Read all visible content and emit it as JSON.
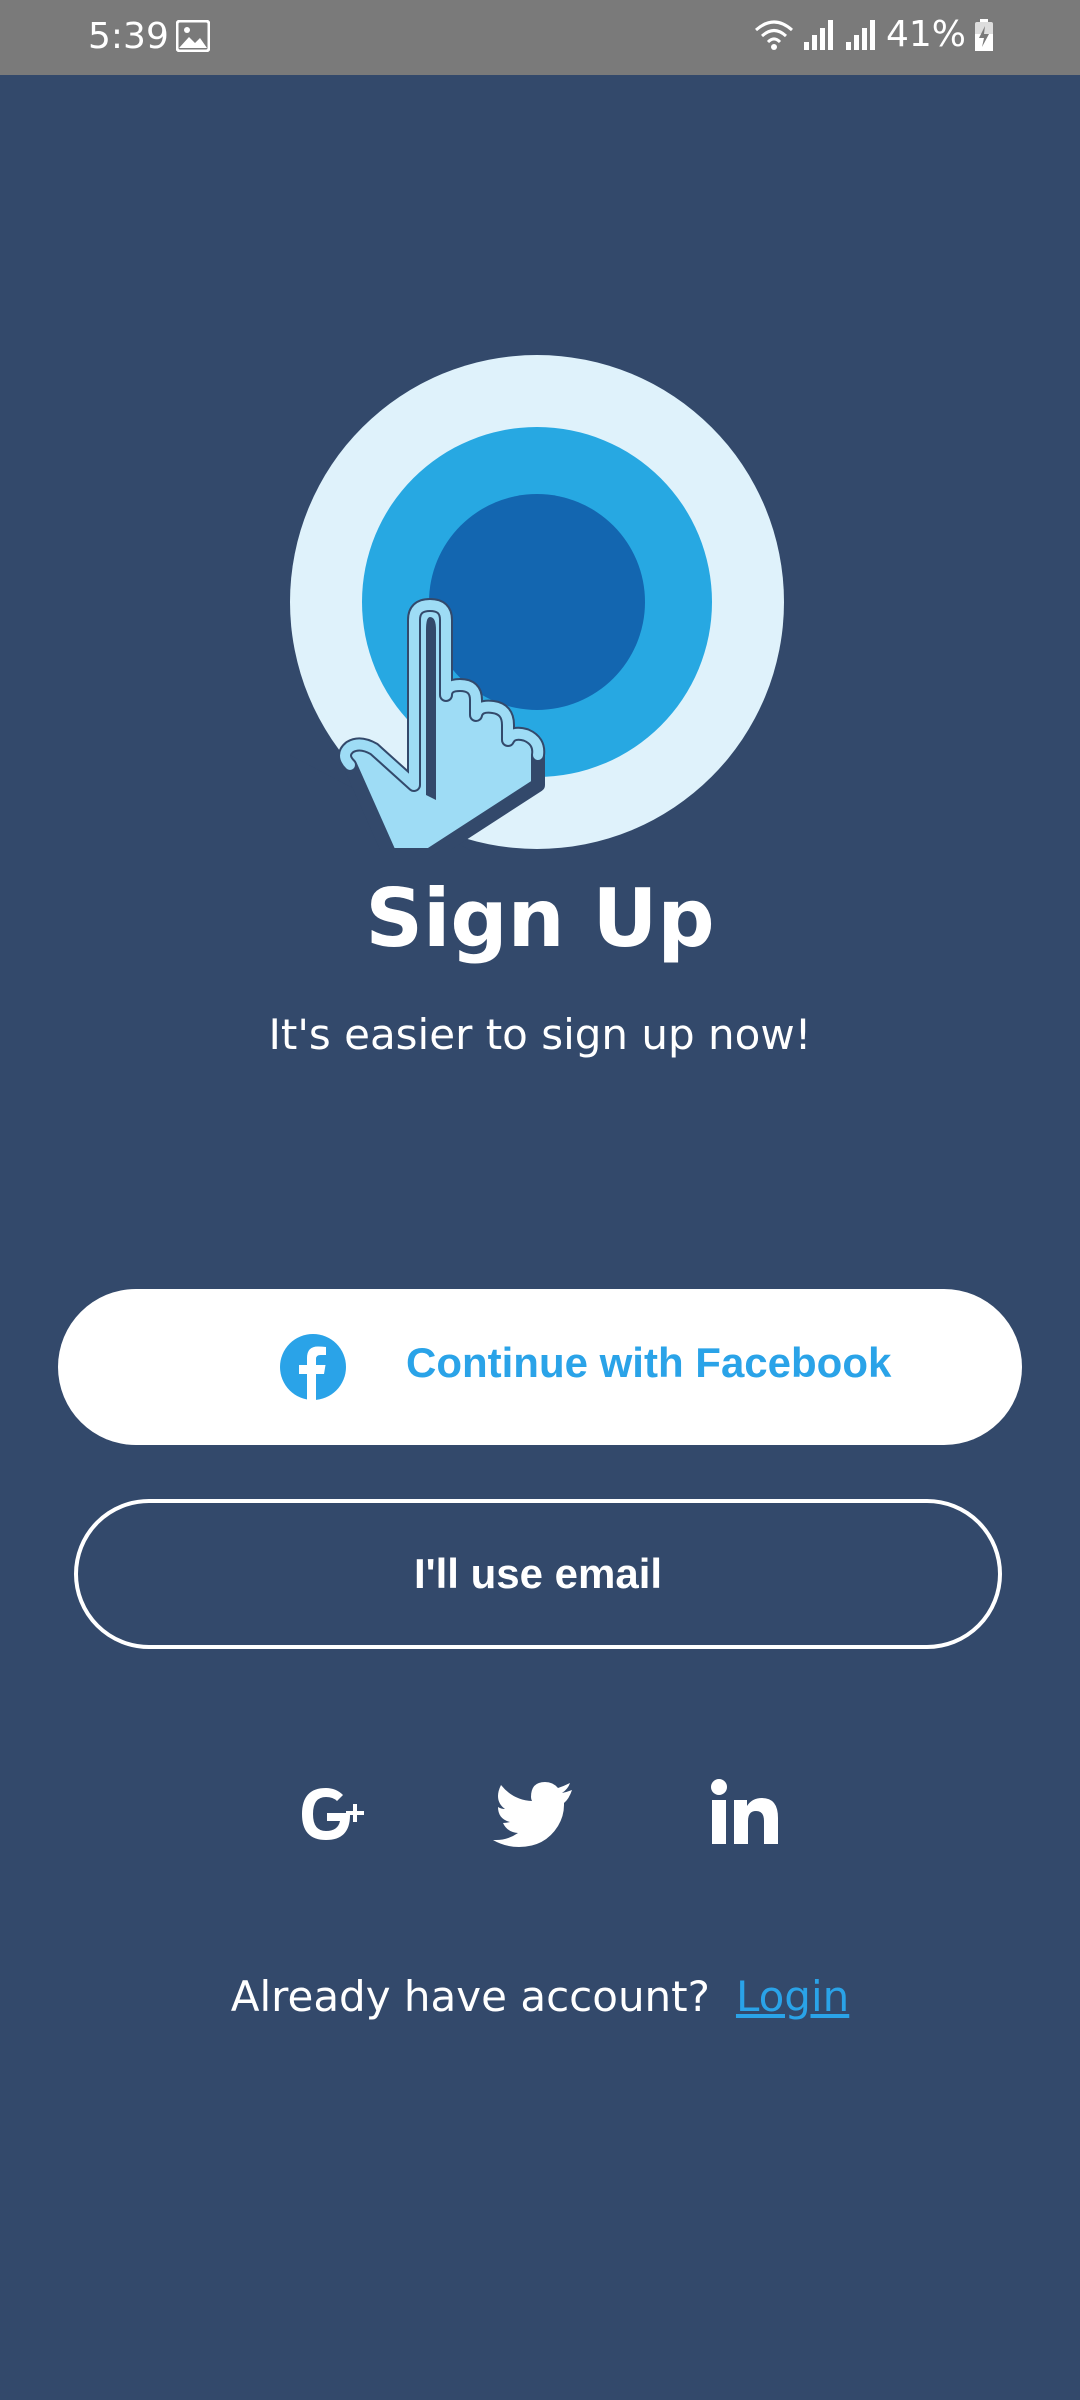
{
  "status_bar": {
    "time": "5:39",
    "battery": "41%"
  },
  "hero": {
    "title": "Sign Up",
    "subtitle": "It's easier to sign up now!"
  },
  "buttons": {
    "facebook_label": "Continue with Facebook",
    "email_label": "I'll use email"
  },
  "social_icons": [
    "google-plus-icon",
    "twitter-icon",
    "linkedin-icon"
  ],
  "footer": {
    "prompt": "Already have account?",
    "login_label": "Login"
  },
  "colors": {
    "background": "#33496B",
    "accent": "#2AA3E8",
    "status_bar": "#7A7A7A"
  }
}
